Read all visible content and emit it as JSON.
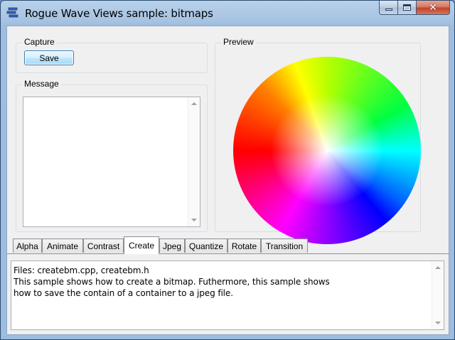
{
  "window": {
    "title": "Rogue Wave Views sample: bitmaps",
    "close_glyph": "✕"
  },
  "capture": {
    "label": "Capture",
    "save_label": "Save"
  },
  "message": {
    "label": "Message",
    "text": ""
  },
  "preview": {
    "label": "Preview"
  },
  "tabs": [
    {
      "label": "Alpha"
    },
    {
      "label": "Animate"
    },
    {
      "label": "Contrast"
    },
    {
      "label": "Create"
    },
    {
      "label": "Jpeg"
    },
    {
      "label": "Quantize"
    },
    {
      "label": "Rotate"
    },
    {
      "label": "Transition"
    }
  ],
  "active_tab": "Create",
  "description": {
    "lines": [
      "Files: createbm.cpp, createbm.h",
      "This sample shows how to create a bitmap. Futhermore, this sample shows",
      "how to save the contain of a container to a jpeg file."
    ]
  },
  "colors": {
    "accent": "#3c7fb1",
    "frame": "#9dbcdf",
    "close_button": "#c2432a"
  },
  "icons": {
    "app": "app-stack-icon",
    "minimize": "minimize-icon",
    "maximize": "maximize-icon",
    "close": "close-icon"
  }
}
